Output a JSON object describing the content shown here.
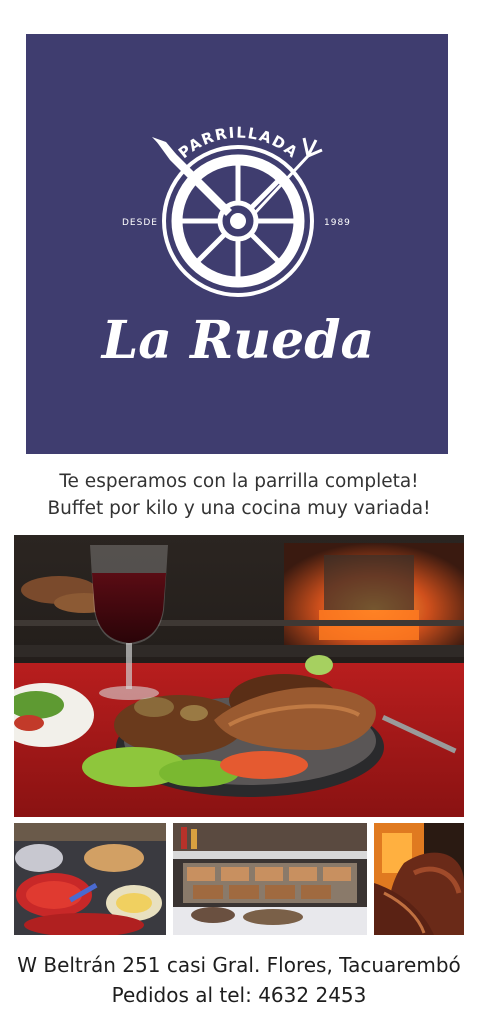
{
  "logo": {
    "top_text": "PARRILLADA",
    "since_label": "DESDE",
    "since_year": "1989",
    "brand_name": "La Rueda",
    "background_color": "#3f3d6f"
  },
  "tagline": {
    "line1": "Te esperamos con la parrilla completa!",
    "line2": "Buffet por kilo y una cocina muy variada!"
  },
  "footer": {
    "address": "W Beltrán 251 casi Gral. Flores, Tacuarembó",
    "phone_line": "Pedidos al tel: 4632 2453"
  }
}
